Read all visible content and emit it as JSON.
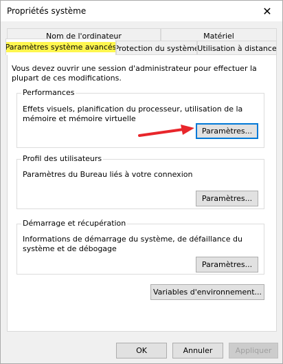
{
  "window": {
    "title": "Propriétés système"
  },
  "tabs": {
    "row1": [
      {
        "label": "Nom de l'ordinateur"
      },
      {
        "label": "Matériel"
      }
    ],
    "row2": [
      {
        "label": "Paramètres système avancés",
        "active": true
      },
      {
        "label": "Protection du système"
      },
      {
        "label": "Utilisation à distance"
      }
    ]
  },
  "intro_text": "Vous devez ouvrir une session d'administrateur pour effectuer la plupart de ces modifications.",
  "performance": {
    "label": "Performances",
    "description": "Effets visuels, planification du processeur, utilisation de la mémoire et mémoire virtuelle",
    "button": "Paramètres..."
  },
  "user_profiles": {
    "label": "Profil des utilisateurs",
    "description": "Paramètres du Bureau liés à votre connexion",
    "button": "Paramètres..."
  },
  "startup_recovery": {
    "label": "Démarrage et récupération",
    "description": "Informations de démarrage du système, de défaillance du système et de débogage",
    "button": "Paramètres..."
  },
  "env_vars_button": "Variables d'environnement...",
  "footer": {
    "ok": "OK",
    "cancel": "Annuler",
    "apply": "Appliquer"
  },
  "colors": {
    "highlight": "#fff64f",
    "arrow": "#e8262b",
    "focus": "#0078d7"
  }
}
